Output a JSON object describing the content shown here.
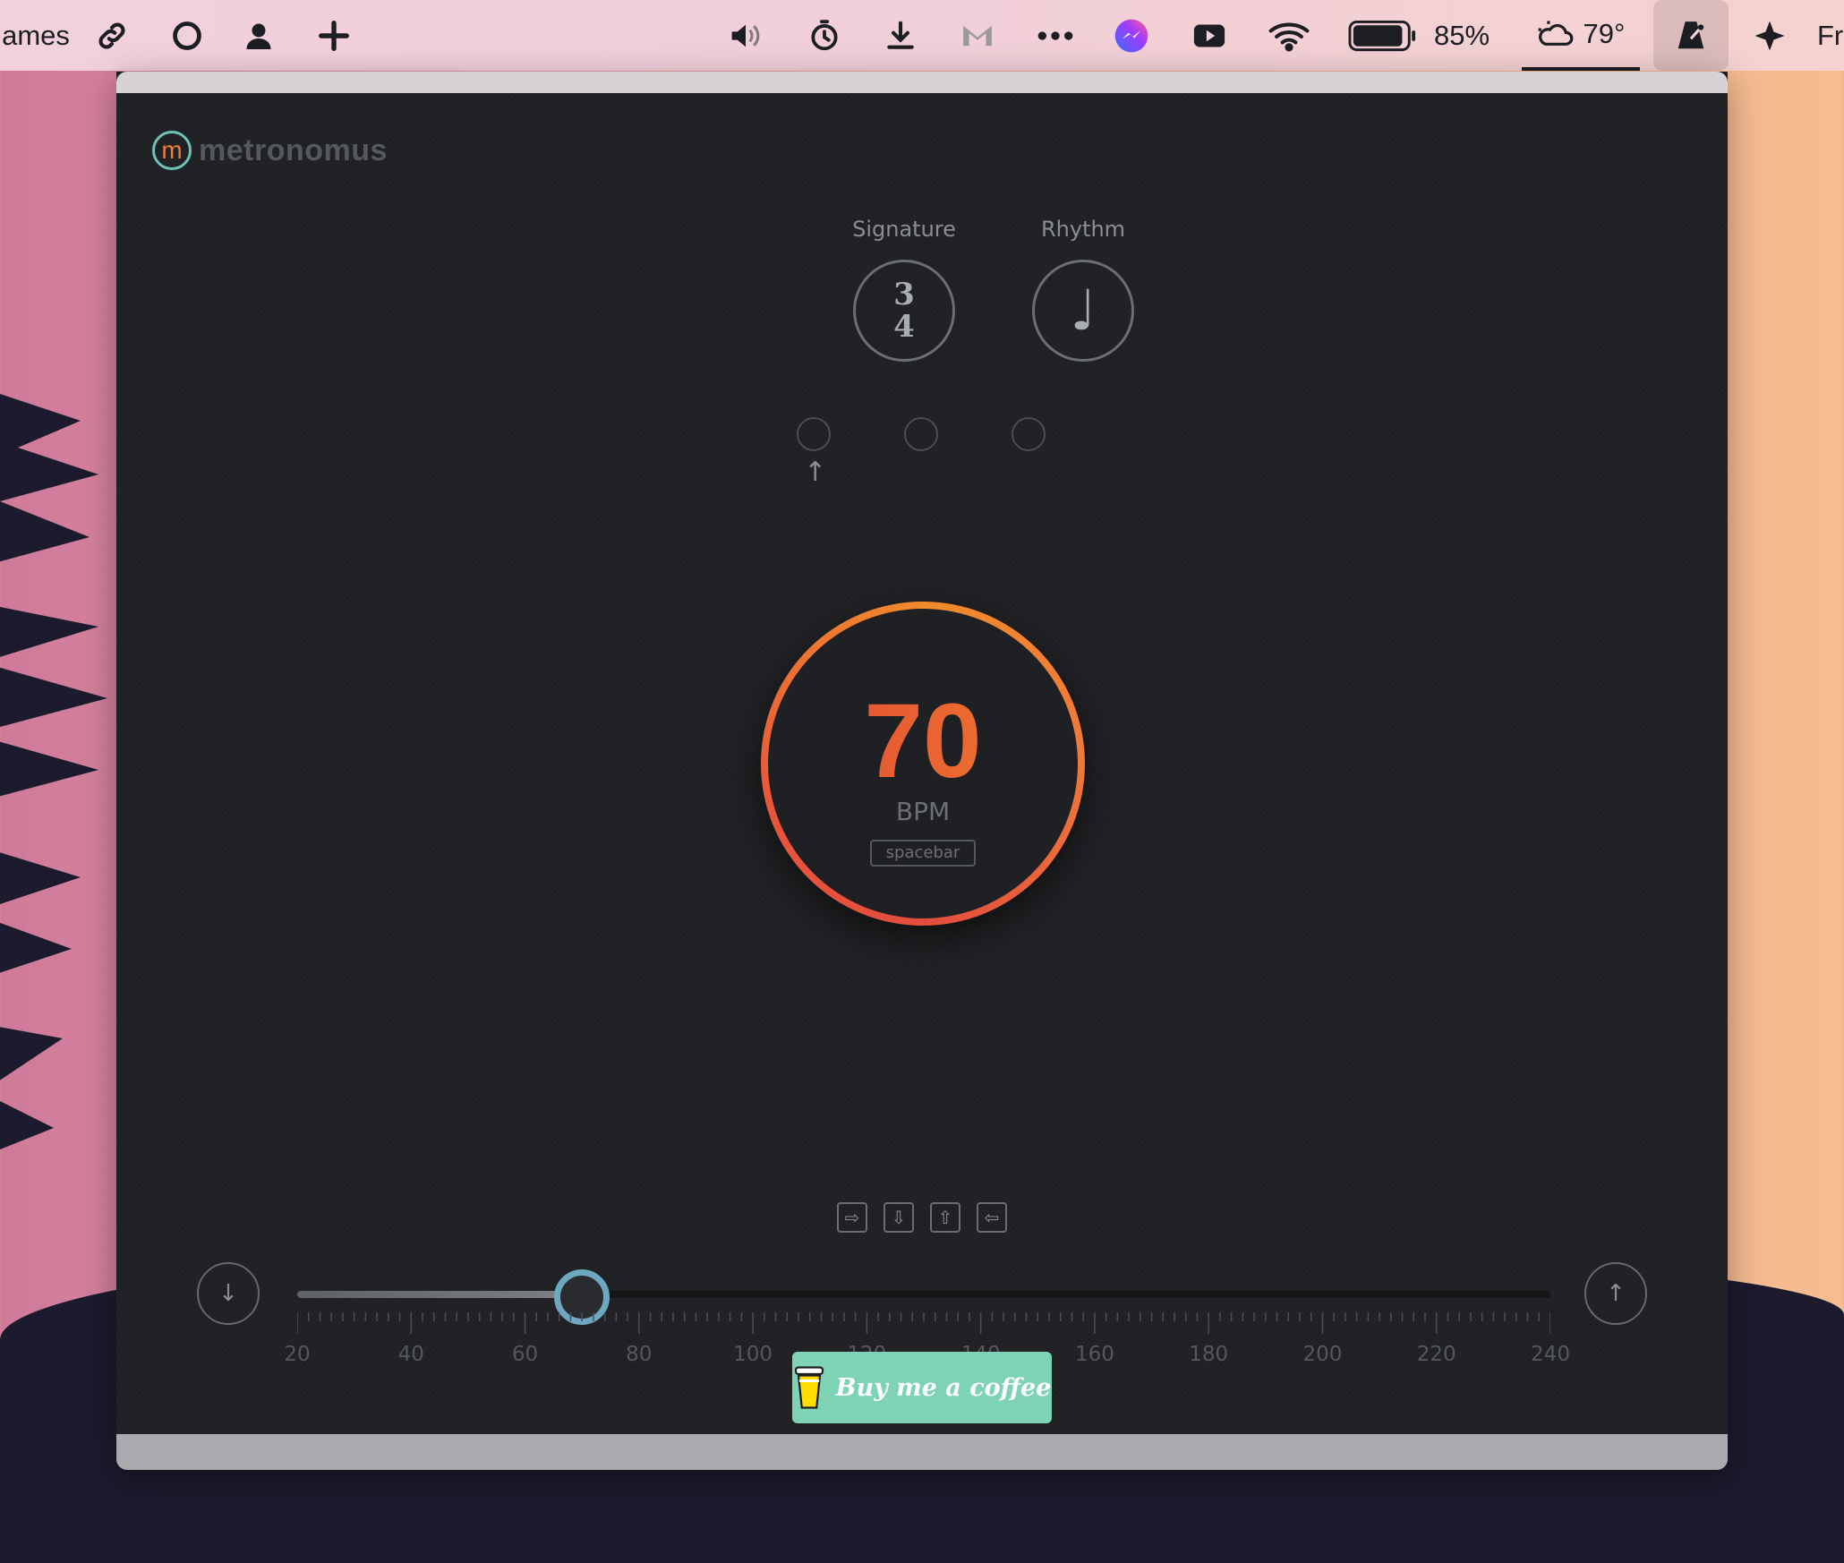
{
  "menubar": {
    "left_text": "ames",
    "battery_percent": "85%",
    "temperature": "79°",
    "right_text": "Fr",
    "icons": [
      "link-icon",
      "circle-icon",
      "person-icon",
      "plus-icon",
      "speaker-icon",
      "timer-icon",
      "download-icon",
      "gmail-icon",
      "more-icon",
      "messenger-icon",
      "youtube-icon",
      "wifi-icon",
      "battery-icon",
      "weather-icon",
      "metronome-icon",
      "sparkle-icon"
    ]
  },
  "app": {
    "brand_letter": "m",
    "brand_name": "metronomus",
    "signature": {
      "label": "Signature",
      "numerator": "3",
      "denominator": "4"
    },
    "rhythm": {
      "label": "Rhythm",
      "symbol": "♩"
    },
    "beats": {
      "count": 3,
      "current": 1,
      "arrow": "↑"
    },
    "tempo": {
      "value": "70",
      "unit": "BPM",
      "hint": "spacebar"
    },
    "shortcut_keys": [
      "⇨",
      "⇩",
      "⇧",
      "⇦"
    ],
    "slider": {
      "min": 20,
      "max": 240,
      "value": 70,
      "tick_labels": [
        "20",
        "40",
        "60",
        "80",
        "100",
        "120",
        "140",
        "160",
        "180",
        "200",
        "220",
        "240"
      ],
      "decrease_symbol": "↓",
      "increase_symbol": "↑"
    },
    "coffee_label": "Buy me a coffee"
  },
  "colors": {
    "accent_orange": "#f08a2b",
    "accent_red": "#e34d3d",
    "slider_thumb": "#6ea7c0",
    "coffee_button": "#7dd3b4",
    "background": "#1e1f22"
  }
}
